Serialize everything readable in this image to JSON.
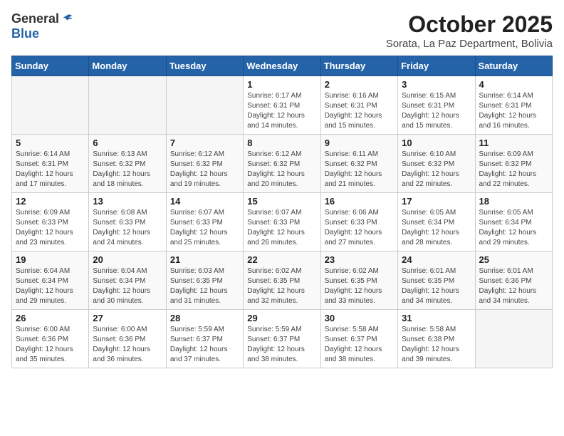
{
  "header": {
    "logo_general": "General",
    "logo_blue": "Blue",
    "title": "October 2025",
    "subtitle": "Sorata, La Paz Department, Bolivia"
  },
  "days_of_week": [
    "Sunday",
    "Monday",
    "Tuesday",
    "Wednesday",
    "Thursday",
    "Friday",
    "Saturday"
  ],
  "weeks": [
    [
      {
        "day": "",
        "info": ""
      },
      {
        "day": "",
        "info": ""
      },
      {
        "day": "",
        "info": ""
      },
      {
        "day": "1",
        "info": "Sunrise: 6:17 AM\nSunset: 6:31 PM\nDaylight: 12 hours\nand 14 minutes."
      },
      {
        "day": "2",
        "info": "Sunrise: 6:16 AM\nSunset: 6:31 PM\nDaylight: 12 hours\nand 15 minutes."
      },
      {
        "day": "3",
        "info": "Sunrise: 6:15 AM\nSunset: 6:31 PM\nDaylight: 12 hours\nand 15 minutes."
      },
      {
        "day": "4",
        "info": "Sunrise: 6:14 AM\nSunset: 6:31 PM\nDaylight: 12 hours\nand 16 minutes."
      }
    ],
    [
      {
        "day": "5",
        "info": "Sunrise: 6:14 AM\nSunset: 6:31 PM\nDaylight: 12 hours\nand 17 minutes."
      },
      {
        "day": "6",
        "info": "Sunrise: 6:13 AM\nSunset: 6:32 PM\nDaylight: 12 hours\nand 18 minutes."
      },
      {
        "day": "7",
        "info": "Sunrise: 6:12 AM\nSunset: 6:32 PM\nDaylight: 12 hours\nand 19 minutes."
      },
      {
        "day": "8",
        "info": "Sunrise: 6:12 AM\nSunset: 6:32 PM\nDaylight: 12 hours\nand 20 minutes."
      },
      {
        "day": "9",
        "info": "Sunrise: 6:11 AM\nSunset: 6:32 PM\nDaylight: 12 hours\nand 21 minutes."
      },
      {
        "day": "10",
        "info": "Sunrise: 6:10 AM\nSunset: 6:32 PM\nDaylight: 12 hours\nand 22 minutes."
      },
      {
        "day": "11",
        "info": "Sunrise: 6:09 AM\nSunset: 6:32 PM\nDaylight: 12 hours\nand 22 minutes."
      }
    ],
    [
      {
        "day": "12",
        "info": "Sunrise: 6:09 AM\nSunset: 6:33 PM\nDaylight: 12 hours\nand 23 minutes."
      },
      {
        "day": "13",
        "info": "Sunrise: 6:08 AM\nSunset: 6:33 PM\nDaylight: 12 hours\nand 24 minutes."
      },
      {
        "day": "14",
        "info": "Sunrise: 6:07 AM\nSunset: 6:33 PM\nDaylight: 12 hours\nand 25 minutes."
      },
      {
        "day": "15",
        "info": "Sunrise: 6:07 AM\nSunset: 6:33 PM\nDaylight: 12 hours\nand 26 minutes."
      },
      {
        "day": "16",
        "info": "Sunrise: 6:06 AM\nSunset: 6:33 PM\nDaylight: 12 hours\nand 27 minutes."
      },
      {
        "day": "17",
        "info": "Sunrise: 6:05 AM\nSunset: 6:34 PM\nDaylight: 12 hours\nand 28 minutes."
      },
      {
        "day": "18",
        "info": "Sunrise: 6:05 AM\nSunset: 6:34 PM\nDaylight: 12 hours\nand 29 minutes."
      }
    ],
    [
      {
        "day": "19",
        "info": "Sunrise: 6:04 AM\nSunset: 6:34 PM\nDaylight: 12 hours\nand 29 minutes."
      },
      {
        "day": "20",
        "info": "Sunrise: 6:04 AM\nSunset: 6:34 PM\nDaylight: 12 hours\nand 30 minutes."
      },
      {
        "day": "21",
        "info": "Sunrise: 6:03 AM\nSunset: 6:35 PM\nDaylight: 12 hours\nand 31 minutes."
      },
      {
        "day": "22",
        "info": "Sunrise: 6:02 AM\nSunset: 6:35 PM\nDaylight: 12 hours\nand 32 minutes."
      },
      {
        "day": "23",
        "info": "Sunrise: 6:02 AM\nSunset: 6:35 PM\nDaylight: 12 hours\nand 33 minutes."
      },
      {
        "day": "24",
        "info": "Sunrise: 6:01 AM\nSunset: 6:35 PM\nDaylight: 12 hours\nand 34 minutes."
      },
      {
        "day": "25",
        "info": "Sunrise: 6:01 AM\nSunset: 6:36 PM\nDaylight: 12 hours\nand 34 minutes."
      }
    ],
    [
      {
        "day": "26",
        "info": "Sunrise: 6:00 AM\nSunset: 6:36 PM\nDaylight: 12 hours\nand 35 minutes."
      },
      {
        "day": "27",
        "info": "Sunrise: 6:00 AM\nSunset: 6:36 PM\nDaylight: 12 hours\nand 36 minutes."
      },
      {
        "day": "28",
        "info": "Sunrise: 5:59 AM\nSunset: 6:37 PM\nDaylight: 12 hours\nand 37 minutes."
      },
      {
        "day": "29",
        "info": "Sunrise: 5:59 AM\nSunset: 6:37 PM\nDaylight: 12 hours\nand 38 minutes."
      },
      {
        "day": "30",
        "info": "Sunrise: 5:58 AM\nSunset: 6:37 PM\nDaylight: 12 hours\nand 38 minutes."
      },
      {
        "day": "31",
        "info": "Sunrise: 5:58 AM\nSunset: 6:38 PM\nDaylight: 12 hours\nand 39 minutes."
      },
      {
        "day": "",
        "info": ""
      }
    ]
  ]
}
